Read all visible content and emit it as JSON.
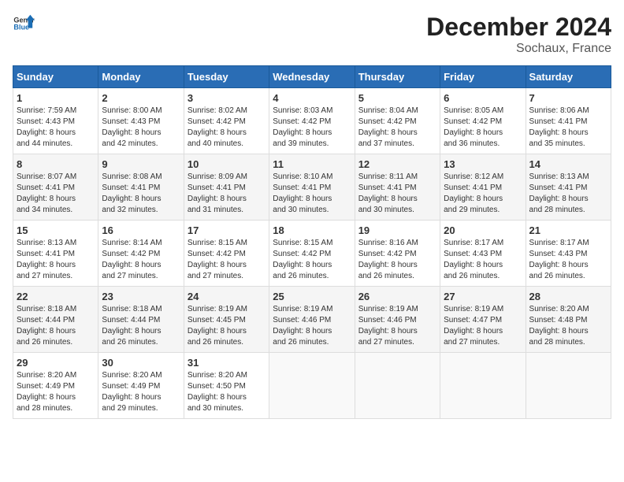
{
  "logo": {
    "line1": "General",
    "line2": "Blue"
  },
  "title": "December 2024",
  "subtitle": "Sochaux, France",
  "headers": [
    "Sunday",
    "Monday",
    "Tuesday",
    "Wednesday",
    "Thursday",
    "Friday",
    "Saturday"
  ],
  "weeks": [
    [
      {
        "day": "1",
        "sunrise": "7:59 AM",
        "sunset": "4:43 PM",
        "daylight": "8 hours and 44 minutes."
      },
      {
        "day": "2",
        "sunrise": "8:00 AM",
        "sunset": "4:43 PM",
        "daylight": "8 hours and 42 minutes."
      },
      {
        "day": "3",
        "sunrise": "8:02 AM",
        "sunset": "4:42 PM",
        "daylight": "8 hours and 40 minutes."
      },
      {
        "day": "4",
        "sunrise": "8:03 AM",
        "sunset": "4:42 PM",
        "daylight": "8 hours and 39 minutes."
      },
      {
        "day": "5",
        "sunrise": "8:04 AM",
        "sunset": "4:42 PM",
        "daylight": "8 hours and 37 minutes."
      },
      {
        "day": "6",
        "sunrise": "8:05 AM",
        "sunset": "4:42 PM",
        "daylight": "8 hours and 36 minutes."
      },
      {
        "day": "7",
        "sunrise": "8:06 AM",
        "sunset": "4:41 PM",
        "daylight": "8 hours and 35 minutes."
      }
    ],
    [
      {
        "day": "8",
        "sunrise": "8:07 AM",
        "sunset": "4:41 PM",
        "daylight": "8 hours and 34 minutes."
      },
      {
        "day": "9",
        "sunrise": "8:08 AM",
        "sunset": "4:41 PM",
        "daylight": "8 hours and 32 minutes."
      },
      {
        "day": "10",
        "sunrise": "8:09 AM",
        "sunset": "4:41 PM",
        "daylight": "8 hours and 31 minutes."
      },
      {
        "day": "11",
        "sunrise": "8:10 AM",
        "sunset": "4:41 PM",
        "daylight": "8 hours and 30 minutes."
      },
      {
        "day": "12",
        "sunrise": "8:11 AM",
        "sunset": "4:41 PM",
        "daylight": "8 hours and 30 minutes."
      },
      {
        "day": "13",
        "sunrise": "8:12 AM",
        "sunset": "4:41 PM",
        "daylight": "8 hours and 29 minutes."
      },
      {
        "day": "14",
        "sunrise": "8:13 AM",
        "sunset": "4:41 PM",
        "daylight": "8 hours and 28 minutes."
      }
    ],
    [
      {
        "day": "15",
        "sunrise": "8:13 AM",
        "sunset": "4:41 PM",
        "daylight": "8 hours and 27 minutes."
      },
      {
        "day": "16",
        "sunrise": "8:14 AM",
        "sunset": "4:42 PM",
        "daylight": "8 hours and 27 minutes."
      },
      {
        "day": "17",
        "sunrise": "8:15 AM",
        "sunset": "4:42 PM",
        "daylight": "8 hours and 27 minutes."
      },
      {
        "day": "18",
        "sunrise": "8:15 AM",
        "sunset": "4:42 PM",
        "daylight": "8 hours and 26 minutes."
      },
      {
        "day": "19",
        "sunrise": "8:16 AM",
        "sunset": "4:42 PM",
        "daylight": "8 hours and 26 minutes."
      },
      {
        "day": "20",
        "sunrise": "8:17 AM",
        "sunset": "4:43 PM",
        "daylight": "8 hours and 26 minutes."
      },
      {
        "day": "21",
        "sunrise": "8:17 AM",
        "sunset": "4:43 PM",
        "daylight": "8 hours and 26 minutes."
      }
    ],
    [
      {
        "day": "22",
        "sunrise": "8:18 AM",
        "sunset": "4:44 PM",
        "daylight": "8 hours and 26 minutes."
      },
      {
        "day": "23",
        "sunrise": "8:18 AM",
        "sunset": "4:44 PM",
        "daylight": "8 hours and 26 minutes."
      },
      {
        "day": "24",
        "sunrise": "8:19 AM",
        "sunset": "4:45 PM",
        "daylight": "8 hours and 26 minutes."
      },
      {
        "day": "25",
        "sunrise": "8:19 AM",
        "sunset": "4:46 PM",
        "daylight": "8 hours and 26 minutes."
      },
      {
        "day": "26",
        "sunrise": "8:19 AM",
        "sunset": "4:46 PM",
        "daylight": "8 hours and 27 minutes."
      },
      {
        "day": "27",
        "sunrise": "8:19 AM",
        "sunset": "4:47 PM",
        "daylight": "8 hours and 27 minutes."
      },
      {
        "day": "28",
        "sunrise": "8:20 AM",
        "sunset": "4:48 PM",
        "daylight": "8 hours and 28 minutes."
      }
    ],
    [
      {
        "day": "29",
        "sunrise": "8:20 AM",
        "sunset": "4:49 PM",
        "daylight": "8 hours and 28 minutes."
      },
      {
        "day": "30",
        "sunrise": "8:20 AM",
        "sunset": "4:49 PM",
        "daylight": "8 hours and 29 minutes."
      },
      {
        "day": "31",
        "sunrise": "8:20 AM",
        "sunset": "4:50 PM",
        "daylight": "8 hours and 30 minutes."
      },
      null,
      null,
      null,
      null
    ]
  ],
  "labels": {
    "sunrise": "Sunrise:",
    "sunset": "Sunset:",
    "daylight": "Daylight:"
  }
}
